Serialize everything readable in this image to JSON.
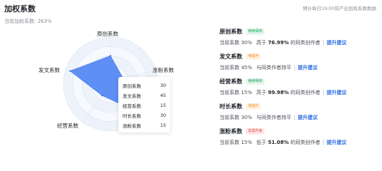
{
  "header": {
    "title": "加权系数",
    "hint": "预计每日19:00前产出加权系数数据",
    "current_label": "当前加权系数: 263%"
  },
  "radar": {
    "axes": [
      "原创系数",
      "发文系数",
      "涨粉系数",
      "经营系数",
      "时长系数"
    ],
    "values": {
      "原创系数": 30,
      "发文系数": 45,
      "经营系数": 15,
      "时长系数": 30,
      "涨粉系数": 15
    },
    "max": 50,
    "fill_color": "#5e8ff5"
  },
  "tooltip": {
    "rows": [
      {
        "label": "原创系数",
        "value": "30"
      },
      {
        "label": "发文系数",
        "value": "45"
      },
      {
        "label": "经营系数",
        "value": "15"
      },
      {
        "label": "时长系数",
        "value": "30"
      },
      {
        "label": "涨粉系数",
        "value": "15"
      }
    ]
  },
  "cards": [
    {
      "name": "原创系数",
      "tag": "继续保持",
      "tag_color": "green",
      "current": "当前系数 30%",
      "compare_prefix": "高于",
      "percent": "76.99%",
      "compare_suffix": "的同类创作者",
      "link": "提升建议"
    },
    {
      "name": "发文系数",
      "tag": "待提升",
      "tag_color": "orange",
      "current": "当前系数 45%",
      "compare_prefix": "与同类作者持平",
      "percent": "",
      "compare_suffix": "",
      "link": "提升建议"
    },
    {
      "name": "经营系数",
      "tag": "继续保持",
      "tag_color": "green",
      "current": "当前系数 15%",
      "compare_prefix": "高于",
      "percent": "99.98%",
      "compare_suffix": "的同类创作者",
      "link": "提升建议"
    },
    {
      "name": "时长系数",
      "tag": "待提升",
      "tag_color": "orange",
      "current": "当前系数 30%",
      "compare_prefix": "与同类作者持平",
      "percent": "",
      "compare_suffix": "",
      "link": "提升建议"
    },
    {
      "name": "涨粉系数",
      "tag": "急需升级",
      "tag_color": "red",
      "current": "当前系数 15%",
      "compare_prefix": "低于",
      "percent": "51.08%",
      "compare_suffix": "的同类创作者",
      "link": "提升建议"
    }
  ]
}
